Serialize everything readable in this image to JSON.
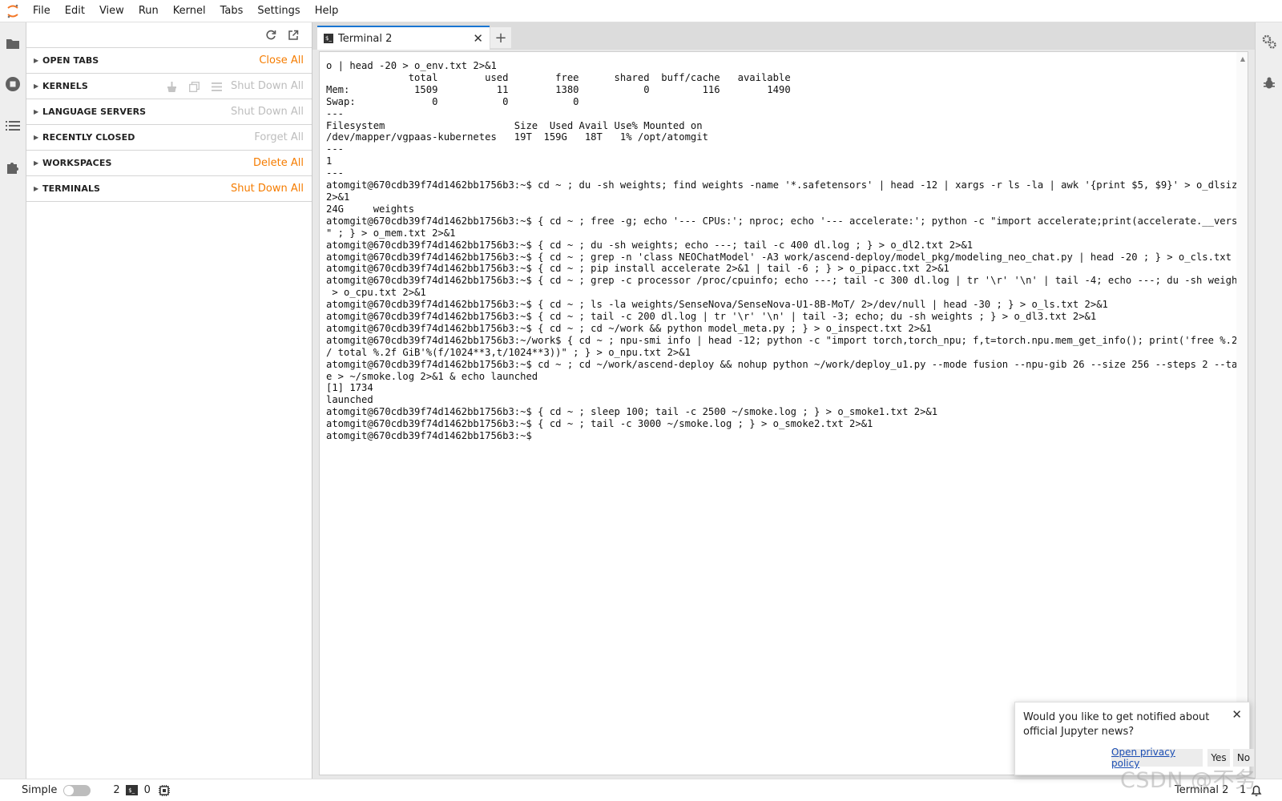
{
  "menu": [
    "File",
    "Edit",
    "View",
    "Run",
    "Kernel",
    "Tabs",
    "Settings",
    "Help"
  ],
  "sidebar": {
    "sections": [
      {
        "title": "OPEN TABS",
        "action": "Close All",
        "enabled": true
      },
      {
        "title": "KERNELS",
        "action": "Shut Down All",
        "enabled": false
      },
      {
        "title": "LANGUAGE SERVERS",
        "action": "Shut Down All",
        "enabled": false
      },
      {
        "title": "RECENTLY CLOSED",
        "action": "Forget All",
        "enabled": false
      },
      {
        "title": "WORKSPACES",
        "action": "Delete All",
        "enabled": true
      },
      {
        "title": "TERMINALS",
        "action": "Shut Down All",
        "enabled": true
      }
    ]
  },
  "tab": {
    "label": "Terminal 2",
    "close_glyph": "✕",
    "add_glyph": "+"
  },
  "terminal": {
    "lines": [
      "o | head -20 > o_env.txt 2>&1",
      "              total        used        free      shared  buff/cache   available",
      "Mem:           1509          11        1380           0         116        1490",
      "Swap:             0           0           0",
      "---",
      "Filesystem                      Size  Used Avail Use% Mounted on",
      "/dev/mapper/vgpaas-kubernetes   19T  159G   18T   1% /opt/atomgit",
      "---",
      "1",
      "---",
      "atomgit@670cdb39f74d1462bb1756b3:~$ cd ~ ; du -sh weights; find weights -name '*.safetensors' | head -12 | xargs -r ls -la | awk '{print $5, $9}' > o_dlsize.txt",
      "2>&1",
      "24G     weights",
      "atomgit@670cdb39f74d1462bb1756b3:~$ { cd ~ ; free -g; echo '--- CPUs:'; nproc; echo '--- accelerate:'; python -c \"import accelerate;print(accelerate.__version__)",
      "\" ; } > o_mem.txt 2>&1",
      "atomgit@670cdb39f74d1462bb1756b3:~$ { cd ~ ; du -sh weights; echo ---; tail -c 400 dl.log ; } > o_dl2.txt 2>&1",
      "atomgit@670cdb39f74d1462bb1756b3:~$ { cd ~ ; grep -n 'class NEOChatModel' -A3 work/ascend-deploy/model_pkg/modeling_neo_chat.py | head -20 ; } > o_cls.txt 2>&1",
      "atomgit@670cdb39f74d1462bb1756b3:~$ { cd ~ ; pip install accelerate 2>&1 | tail -6 ; } > o_pipacc.txt 2>&1",
      "atomgit@670cdb39f74d1462bb1756b3:~$ { cd ~ ; grep -c processor /proc/cpuinfo; echo ---; tail -c 300 dl.log | tr '\\r' '\\n' | tail -4; echo ---; du -sh weights ; }",
      " > o_cpu.txt 2>&1",
      "atomgit@670cdb39f74d1462bb1756b3:~$ { cd ~ ; ls -la weights/SenseNova/SenseNova-U1-8B-MoT/ 2>/dev/null | head -30 ; } > o_ls.txt 2>&1",
      "atomgit@670cdb39f74d1462bb1756b3:~$ { cd ~ ; tail -c 200 dl.log | tr '\\r' '\\n' | tail -3; echo; du -sh weights ; } > o_dl3.txt 2>&1",
      "atomgit@670cdb39f74d1462bb1756b3:~$ { cd ~ ; cd ~/work && python model_meta.py ; } > o_inspect.txt 2>&1",
      "atomgit@670cdb39f74d1462bb1756b3:~/work$ { cd ~ ; npu-smi info | head -12; python -c \"import torch,torch_npu; f,t=torch.npu.mem_get_info(); print('free %.2f GiB",
      "/ total %.2f GiB'%(f/1024**3,t/1024**3))\" ; } > o_npu.txt 2>&1",
      "atomgit@670cdb39f74d1462bb1756b3:~$ cd ~ ; cd ~/work/ascend-deploy && nohup python ~/work/deploy_u1.py --mode fusion --npu-gib 26 --size 256 --steps 2 --tag smok",
      "e > ~/smoke.log 2>&1 & echo launched",
      "[1] 1734",
      "launched",
      "atomgit@670cdb39f74d1462bb1756b3:~$ { cd ~ ; sleep 100; tail -c 2500 ~/smoke.log ; } > o_smoke1.txt 2>&1",
      "atomgit@670cdb39f74d1462bb1756b3:~$ { cd ~ ; tail -c 3000 ~/smoke.log ; } > o_smoke2.txt 2>&1",
      "atomgit@670cdb39f74d1462bb1756b3:~$ "
    ]
  },
  "statusbar": {
    "mode_label": "Simple",
    "terminals_count": "2",
    "kernels_count": "0",
    "current": "Terminal 2",
    "notifications": "1"
  },
  "notification": {
    "message": "Would you like to get notified about official Jupyter news?",
    "privacy_link": "Open privacy policy",
    "yes": "Yes",
    "no": "No",
    "close_glyph": "✕"
  },
  "watermark": "CSDN @不务",
  "colors": {
    "accent": "#f57c00",
    "tab_highlight": "#1976d2",
    "link": "#1a4db3"
  },
  "icons": [
    "jupyter-logo-icon",
    "folder-icon",
    "running-icon",
    "toc-icon",
    "extension-icon",
    "refresh-icon",
    "launch-icon",
    "property-inspector-icon",
    "debugger-icon",
    "terminal-icon",
    "kernel-icon",
    "bell-icon"
  ]
}
